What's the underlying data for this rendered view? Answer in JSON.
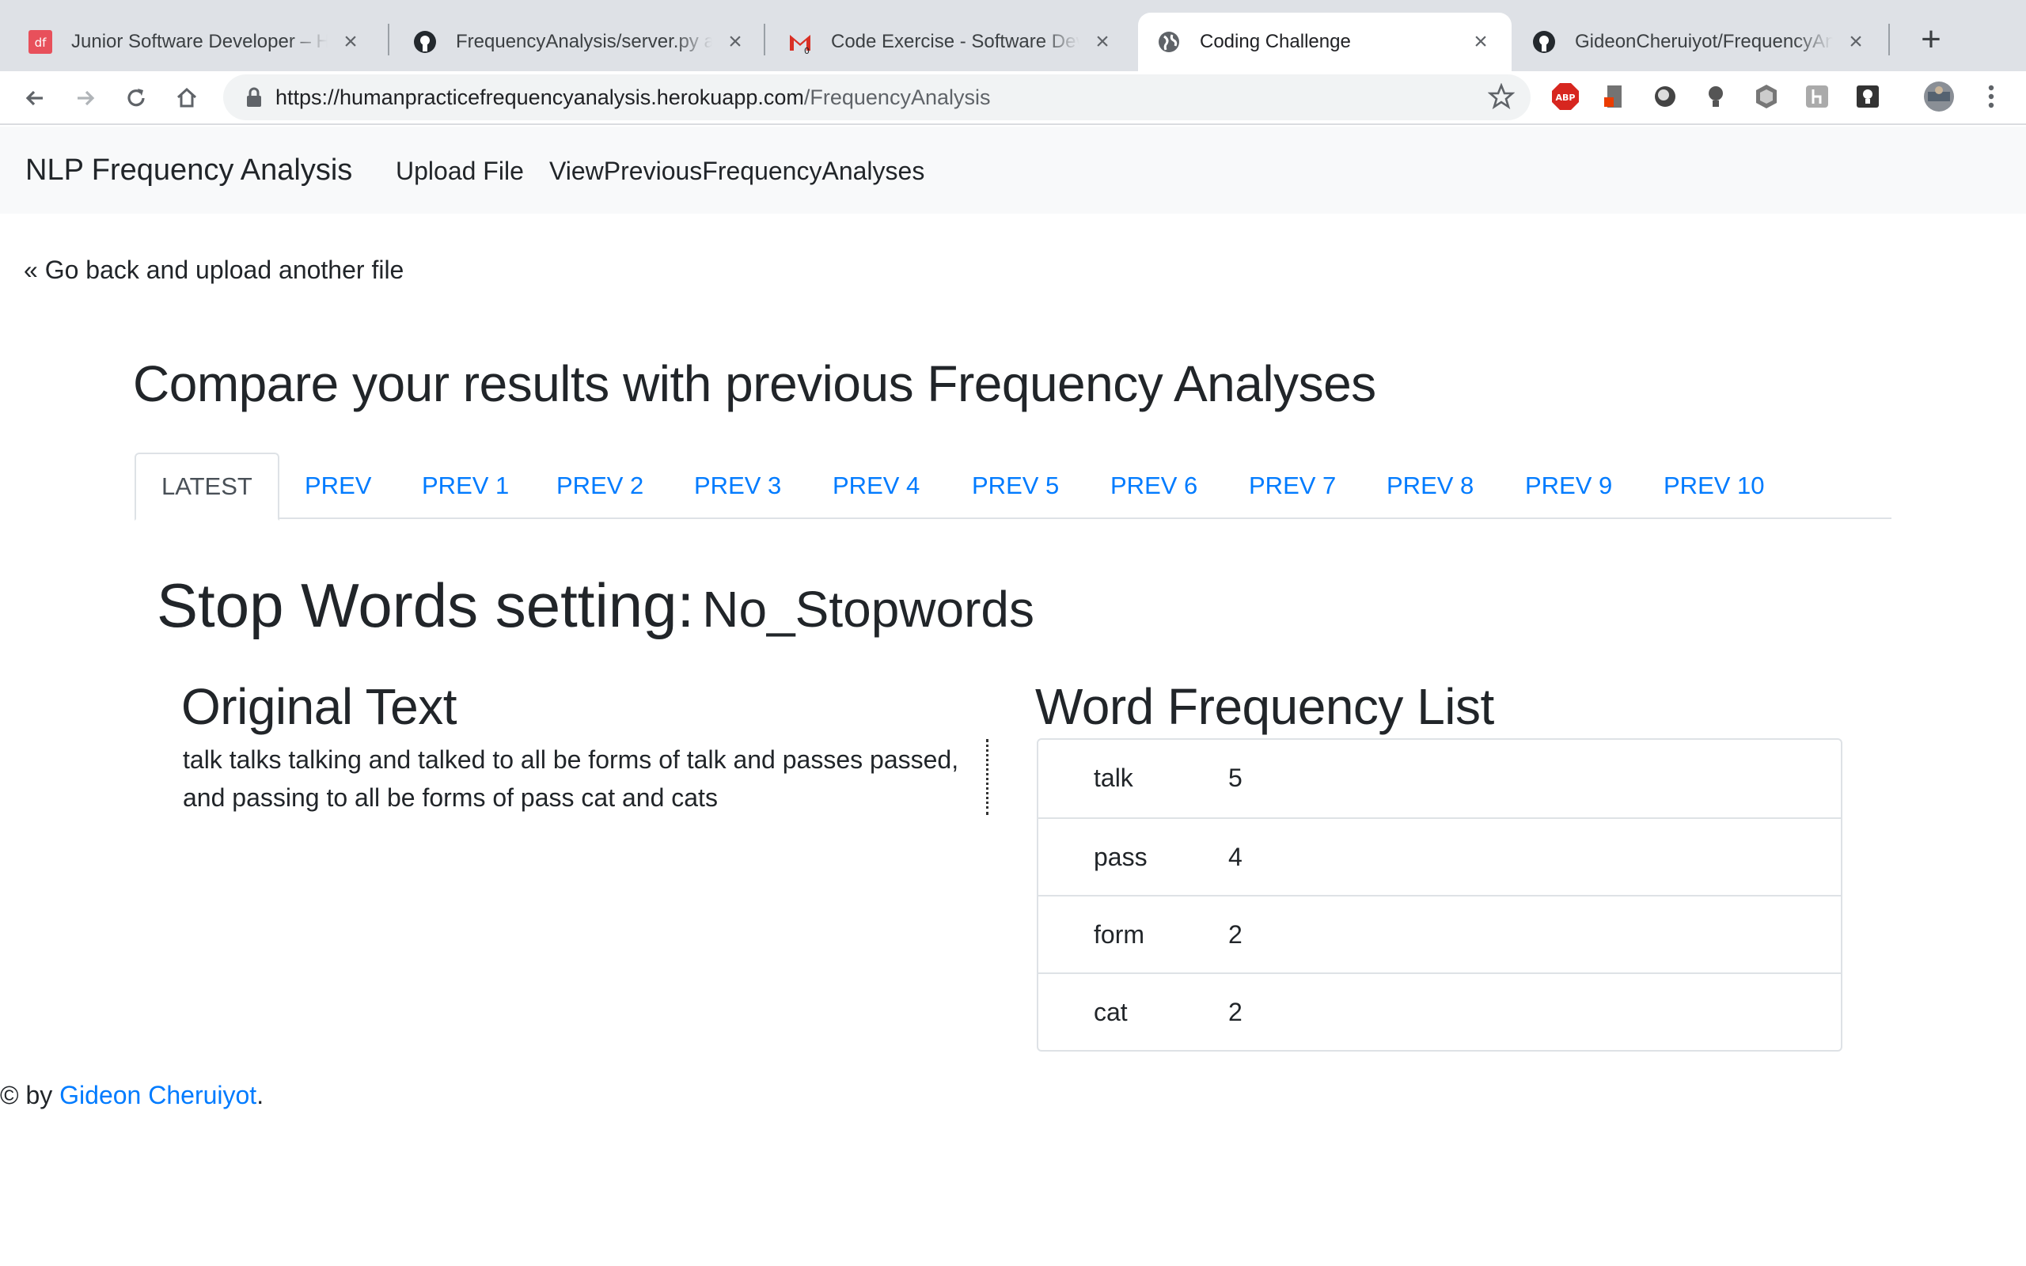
{
  "browser": {
    "tabs": [
      {
        "title": "Junior Software Developer – Human Practice",
        "icon": "df-logo-icon"
      },
      {
        "title": "FrequencyAnalysis/server.py at master",
        "icon": "github-icon"
      },
      {
        "title": "Code Exercise - Software Developer",
        "icon": "gmail-icon",
        "badge": "0"
      },
      {
        "title": "Coding Challenge",
        "icon": "globe-icon",
        "active": true
      },
      {
        "title": "GideonCheruiyot/FrequencyAnalysis",
        "icon": "github-icon"
      }
    ],
    "url_host": "https://humanpracticefrequencyanalysis.herokuapp.com",
    "url_path": "/FrequencyAnalysis",
    "abp_label": "ABP"
  },
  "navbar": {
    "brand": "NLP Frequency Analysis",
    "links": [
      "Upload File",
      "ViewPreviousFrequencyAnalyses"
    ]
  },
  "back_link": "« Go back and upload another file",
  "heading": "Compare your results with previous Frequency Analyses",
  "analysis_tabs": [
    "LATEST",
    "PREV",
    "PREV 1",
    "PREV 2",
    "PREV 3",
    "PREV 4",
    "PREV 5",
    "PREV 6",
    "PREV 7",
    "PREV 8",
    "PREV 9",
    "PREV 10"
  ],
  "stop_words": {
    "label": "Stop Words setting:",
    "value": "No_Stopwords"
  },
  "original_text": {
    "heading": "Original Text",
    "body": "talk talks talking and talked to all be forms of talk and passes passed, and passing to all be forms of pass cat and cats"
  },
  "word_frequency": {
    "heading": "Word Frequency List",
    "rows": [
      {
        "word": "talk",
        "count": "5"
      },
      {
        "word": "pass",
        "count": "4"
      },
      {
        "word": "form",
        "count": "2"
      },
      {
        "word": "cat",
        "count": "2"
      }
    ]
  },
  "footer": {
    "prefix": "© by ",
    "author": "Gideon Cheruiyot",
    "suffix": "."
  },
  "colors": {
    "link": "#007bff",
    "navbar_bg": "#f8f9fa",
    "tabstrip_bg": "#dee1e6"
  }
}
